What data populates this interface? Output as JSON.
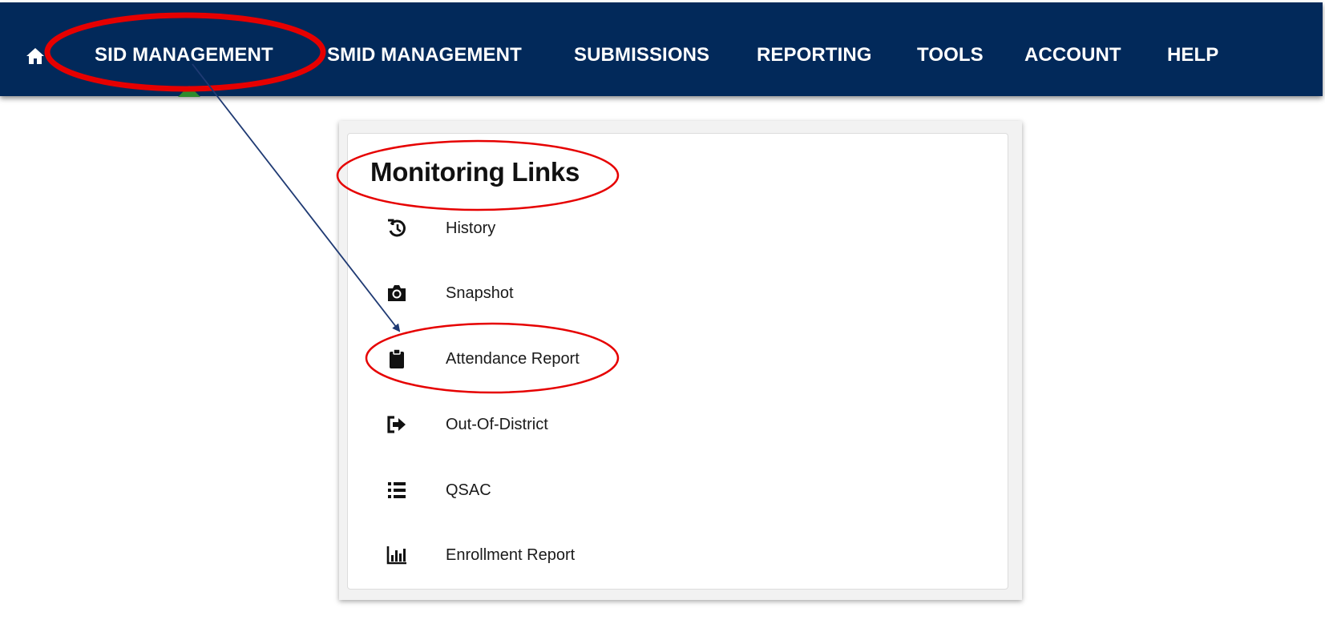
{
  "nav": {
    "home_icon": "home-icon",
    "items": [
      {
        "label": "SID MANAGEMENT",
        "active": true
      },
      {
        "label": "SMID MANAGEMENT"
      },
      {
        "label": "SUBMISSIONS"
      },
      {
        "label": "REPORTING"
      },
      {
        "label": "TOOLS"
      },
      {
        "label": "ACCOUNT"
      },
      {
        "label": "HELP"
      }
    ]
  },
  "panel": {
    "title": "Monitoring Links",
    "links": [
      {
        "label": "History",
        "icon": "history-icon"
      },
      {
        "label": "Snapshot",
        "icon": "camera-icon"
      },
      {
        "label": "Attendance Report",
        "icon": "clipboard-icon"
      },
      {
        "label": "Out-Of-District",
        "icon": "sign-out-icon"
      },
      {
        "label": "QSAC",
        "icon": "list-icon"
      },
      {
        "label": "Enrollment Report",
        "icon": "bar-chart-icon"
      }
    ]
  },
  "colors": {
    "nav_background": "#02295a",
    "annotation_red": "#e60000",
    "arrow_blue": "#1f3a73",
    "active_marker": "#2e8b2e"
  }
}
